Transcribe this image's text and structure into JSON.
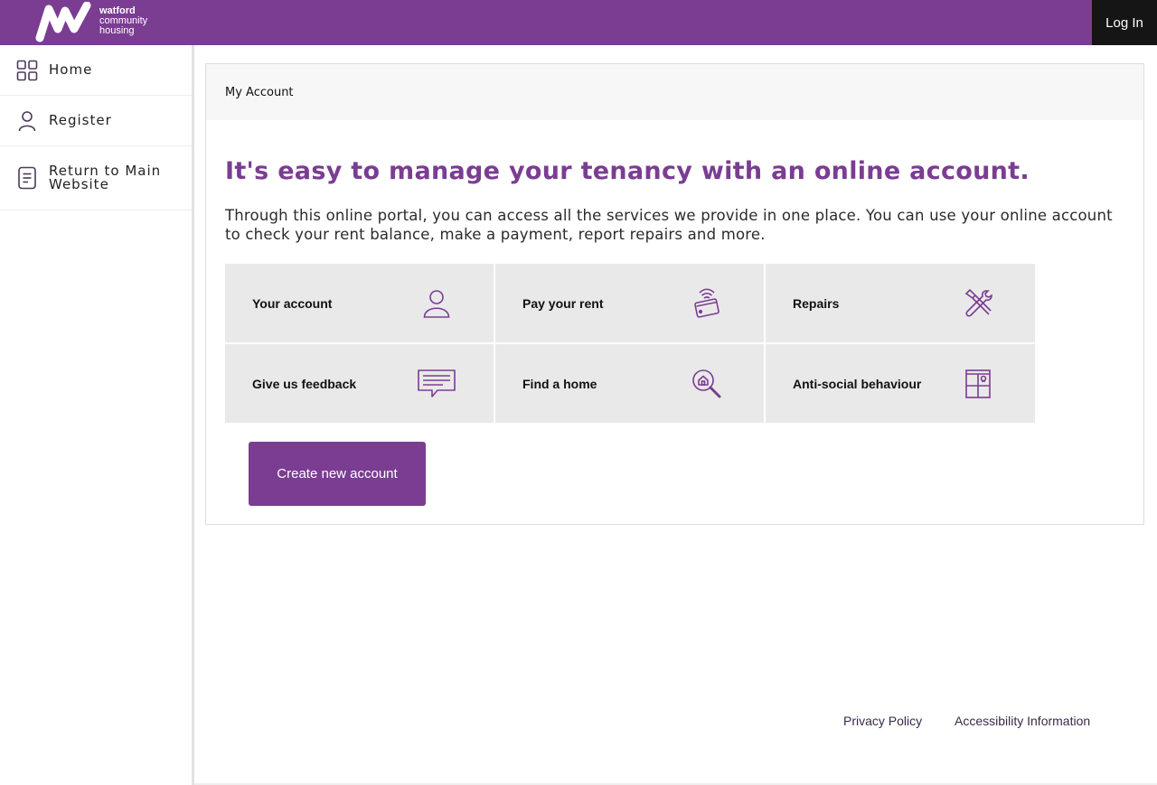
{
  "header": {
    "logo": {
      "line1": "watford",
      "line2": "community",
      "line3": "housing",
      "icon": "wch-logo-mark"
    },
    "login_label": "Log In"
  },
  "sidebar": {
    "items": [
      {
        "label": "Home",
        "icon": "grid-icon"
      },
      {
        "label": "Register",
        "icon": "person-icon"
      },
      {
        "label": "Return to Main Website",
        "icon": "document-icon"
      }
    ]
  },
  "main": {
    "panel_title": "My Account",
    "headline": "It's easy to manage your tenancy with an online account.",
    "intro": "Through this online portal, you can access all the services we provide in one place. You can use your online account to check your rent balance, make a payment, report repairs and more.",
    "tiles": [
      {
        "label": "Your account",
        "icon": "person-icon"
      },
      {
        "label": "Pay your rent",
        "icon": "contactless-card-icon"
      },
      {
        "label": "Repairs",
        "icon": "tools-icon"
      },
      {
        "label": "Give us feedback",
        "icon": "speech-bubble-icon"
      },
      {
        "label": "Find a home",
        "icon": "house-search-icon"
      },
      {
        "label": "Anti-social behaviour",
        "icon": "window-icon"
      }
    ],
    "create_button": "Create new account"
  },
  "footer": {
    "privacy": "Privacy Policy",
    "accessibility": "Accessibility Information"
  },
  "colors": {
    "brand_purple": "#7a3d92",
    "login_bg": "#151515",
    "tile_bg": "#e9e9e9"
  }
}
